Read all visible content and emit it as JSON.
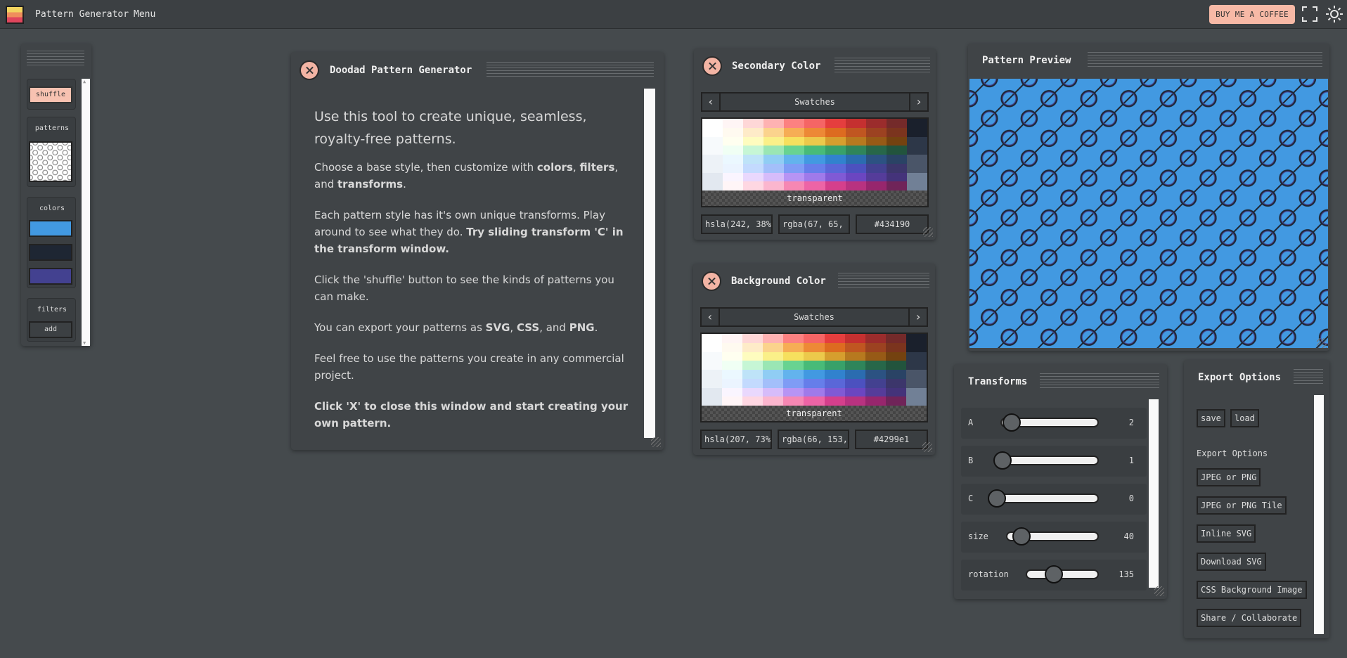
{
  "app": {
    "title": "Pattern Generator",
    "menu_label": "Menu",
    "coffee_label": "BUY ME A COFFEE"
  },
  "tools": {
    "shuffle_label": "shuffle",
    "patterns_label": "patterns",
    "colors_label": "colors",
    "filters_label": "filters",
    "add_label": "add",
    "color_swatches": [
      "#4299e1",
      "#1e2633",
      "#434190"
    ]
  },
  "info": {
    "title": "Doodad Pattern Generator",
    "lead": "Use this tool to create unique, seamless, royalty-free patterns.",
    "p1_pre": "Choose a base style, then customize with ",
    "p1_b1": "colors",
    "p1_sep1": ", ",
    "p1_b2": "filters",
    "p1_sep2": ", and ",
    "p1_b3": "transforms",
    "p1_end": ".",
    "p2_pre": "Each pattern style has it's own unique transforms. Play around to see what they do. ",
    "p2_bold": "Try sliding transform 'C' in the transform window.",
    "p3": "Click the 'shuffle' button to see the kinds of patterns you can make.",
    "p4_pre": "You can export your patterns as ",
    "p4_b1": "SVG",
    "p4_sep1": ", ",
    "p4_b2": "CSS",
    "p4_sep2": ", and ",
    "p4_b3": "PNG",
    "p4_end": ".",
    "p5": "Feel free to use the patterns you create in any commercial project.",
    "p6": "Click 'X' to close this window and start creating your own pattern."
  },
  "secondary_color": {
    "title": "Secondary Color",
    "nav_label": "Swatches",
    "transparent_label": "transparent",
    "hsla": "hsla(242, 38%",
    "rgba": "rgba(67, 65,",
    "hex": "#434190",
    "selected_color": "#434190"
  },
  "background_color": {
    "title": "Background Color",
    "nav_label": "Swatches",
    "transparent_label": "transparent",
    "hsla": "hsla(207, 73%",
    "rgba": "rgba(66, 153,",
    "hex": "#4299e1",
    "selected_color": "#4299e1"
  },
  "preview": {
    "title": "Pattern Preview",
    "bg_color": "#4299e1",
    "fg_color": "#434190",
    "line_color": "#1e2633"
  },
  "transforms": {
    "title": "Transforms",
    "rows": [
      {
        "label": "A",
        "value": "2",
        "fraction": 0.04
      },
      {
        "label": "B",
        "value": "1",
        "fraction": 0.0
      },
      {
        "label": "C",
        "value": "0",
        "fraction": 0.0
      },
      {
        "label": "size",
        "value": "40",
        "fraction": 0.1
      },
      {
        "label": "rotation",
        "value": "135",
        "fraction": 0.375
      }
    ]
  },
  "export": {
    "title": "Export Options",
    "save_label": "save",
    "load_label": "load",
    "section_label": "Export Options",
    "buttons": [
      "JPEG or PNG",
      "JPEG or PNG Tile",
      "Inline SVG",
      "Download SVG",
      "CSS Background Image",
      "Share / Collaborate"
    ]
  }
}
